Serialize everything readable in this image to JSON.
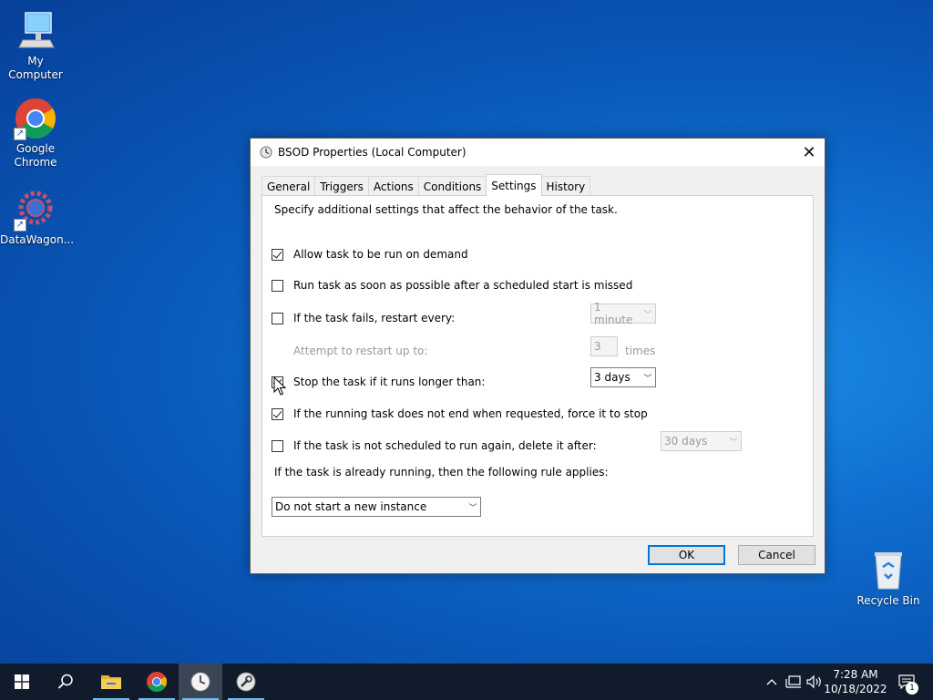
{
  "desktop": {
    "icons": [
      {
        "label": "My Computer"
      },
      {
        "label": "Google Chrome"
      },
      {
        "label": "DataWagon..."
      },
      {
        "label": "Recycle Bin"
      }
    ]
  },
  "dialog": {
    "title": "BSOD Properties (Local Computer)",
    "close_symbol": "✕",
    "tabs": [
      {
        "label": "General",
        "active": false
      },
      {
        "label": "Triggers",
        "active": false
      },
      {
        "label": "Actions",
        "active": false
      },
      {
        "label": "Conditions",
        "active": false
      },
      {
        "label": "Settings",
        "active": true
      },
      {
        "label": "History",
        "active": false
      }
    ],
    "description": "Specify additional settings that affect the behavior of the task.",
    "options": [
      {
        "label": "Allow task to be run on demand",
        "checked": true
      },
      {
        "label": "Run task as soon as possible after a scheduled start is missed",
        "checked": false
      },
      {
        "label": "If the task fails, restart every:",
        "checked": false
      },
      {
        "label": "Stop the task if it runs longer than:",
        "checked": true
      },
      {
        "label": "If the running task does not end when requested, force it to stop",
        "checked": true
      },
      {
        "label": "If the task is not scheduled to run again, delete it after:",
        "checked": false
      }
    ],
    "restart_interval": "1 minute",
    "attempt_label": "Attempt to restart up to:",
    "attempt_count": "3",
    "attempt_unit": "times",
    "stop_after": "3 days",
    "delete_after": "30 days",
    "rule_label": "If the task is already running, then the following rule applies:",
    "rule_value": "Do not start a new instance",
    "ok_label": "OK",
    "cancel_label": "Cancel"
  },
  "taskbar": {
    "time": "7:28 AM",
    "date": "10/18/2022",
    "notification_count": "1"
  },
  "colors": {
    "accent": "#0078d7",
    "taskbar": "#101b2b"
  }
}
